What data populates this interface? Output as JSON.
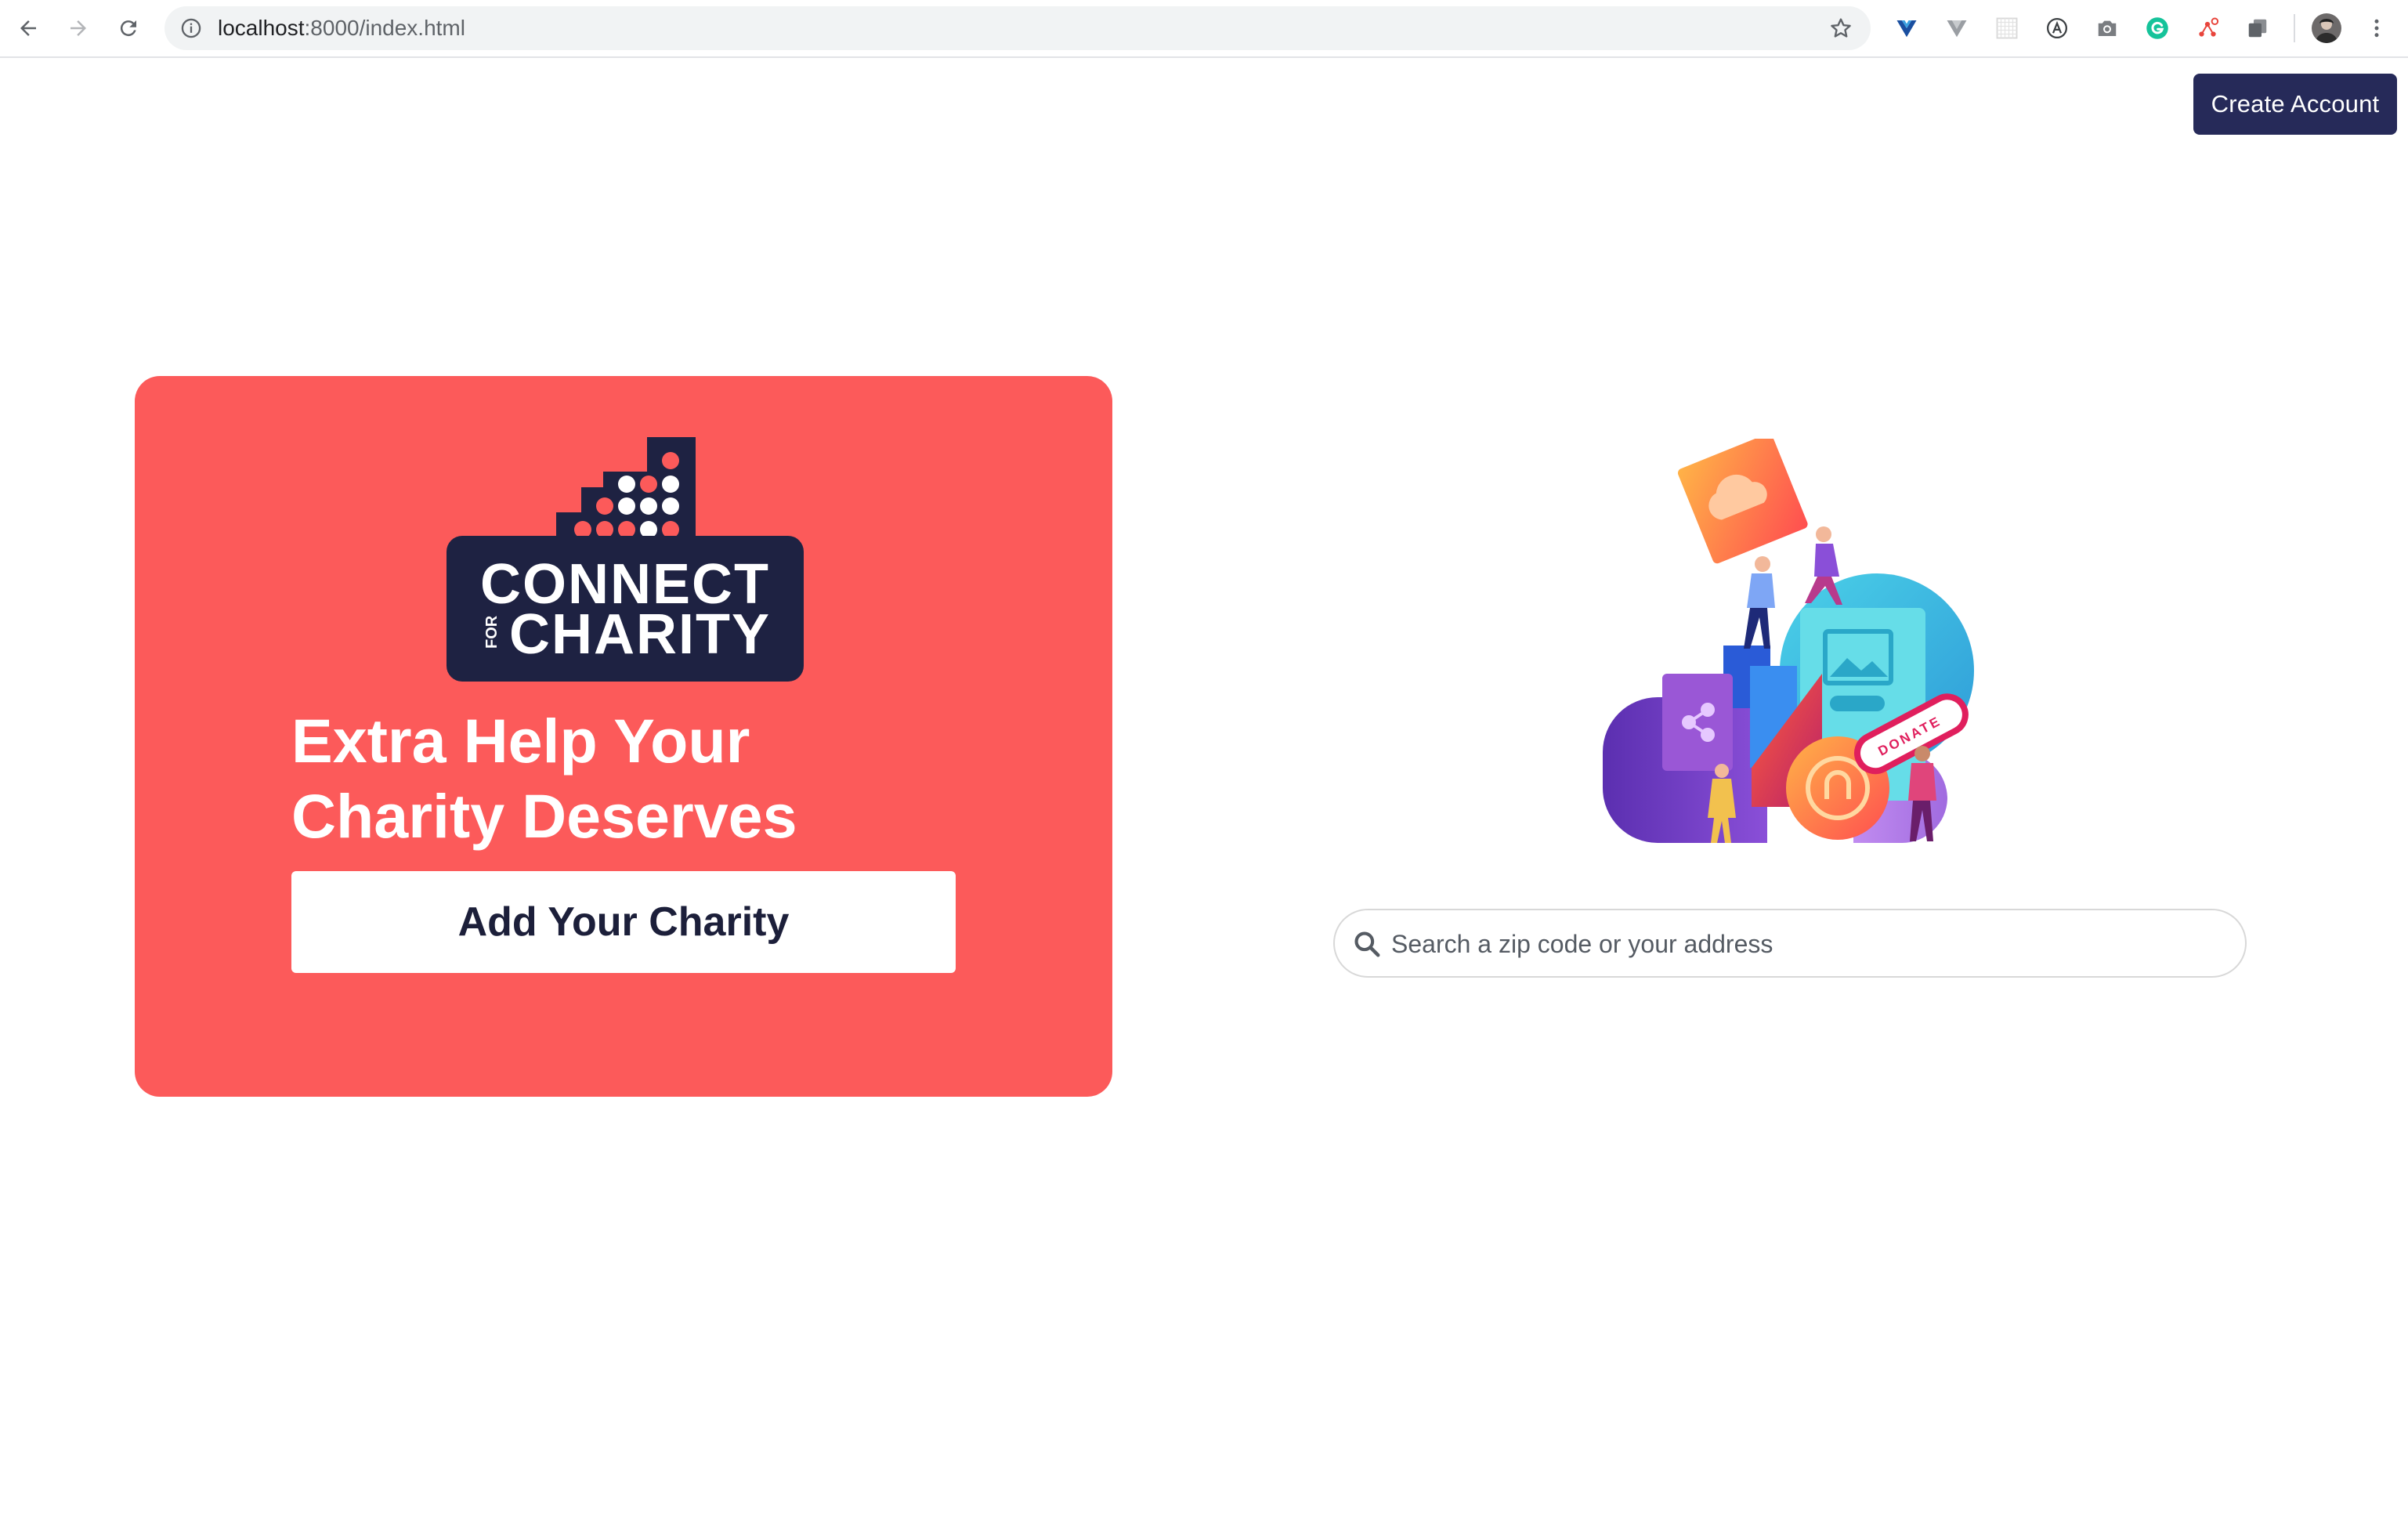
{
  "browser": {
    "url_host": "localhost",
    "url_path": ":8000/index.html",
    "extension_icons": [
      "vue-devtools-icon",
      "vuetify-icon",
      "grid-extension-icon",
      "a-extension-icon",
      "camera-icon",
      "grammarly-icon",
      "network-extension-icon",
      "copy-extension-icon",
      "profile-avatar-icon",
      "menu-kebab-icon"
    ]
  },
  "header": {
    "create_account_label": "Create Account"
  },
  "hero": {
    "logo_text_line1": "CONNECT",
    "logo_text_for": "FOR",
    "logo_text_line2": "CHARITY",
    "tagline_line1": "Extra Help Your",
    "tagline_line2": "Charity Deserves",
    "add_button_label": "Add Your Charity"
  },
  "illustration": {
    "donate_tag": "DONATE"
  },
  "search": {
    "placeholder": "Search a zip code or your address",
    "value": ""
  },
  "colors": {
    "accent_red": "#fc5a5a",
    "navy": "#262a59",
    "logo_navy": "#1e2242"
  }
}
